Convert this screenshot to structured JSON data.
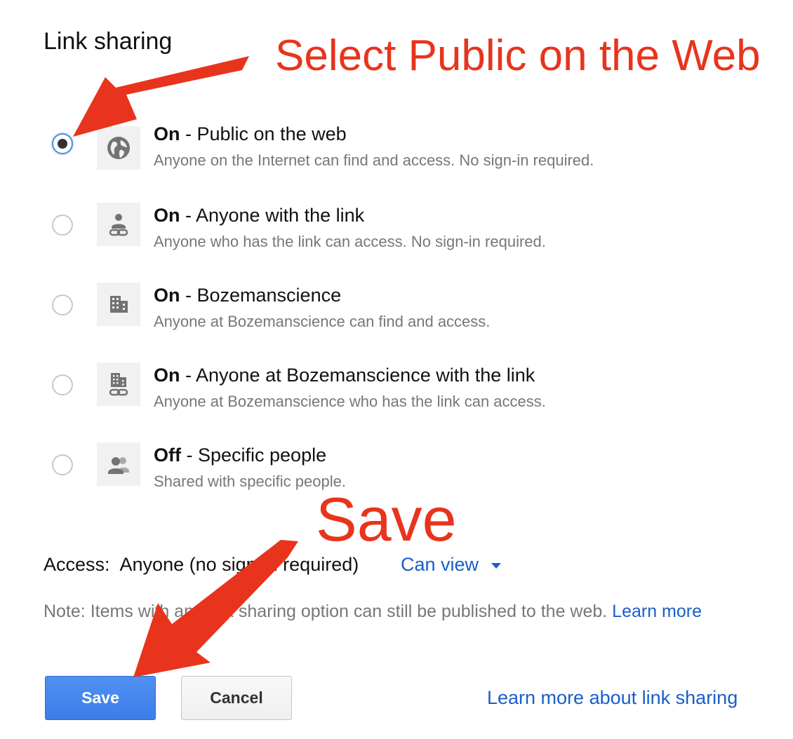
{
  "dialog": {
    "title": "Link sharing"
  },
  "annotations": {
    "top_callout": "Select Public on the Web",
    "save_callout": "Save",
    "color": "#e8341c"
  },
  "options": [
    {
      "state": "On",
      "label": " - Public on the web",
      "description": "Anyone on the Internet can find and access. No sign-in required.",
      "icon": "globe-icon",
      "selected": true
    },
    {
      "state": "On",
      "label": " - Anyone with the link",
      "description": "Anyone who has the link can access. No sign-in required.",
      "icon": "person-link-icon",
      "selected": false
    },
    {
      "state": "On",
      "label": " - Bozemanscience",
      "description": "Anyone at Bozemanscience can find and access.",
      "icon": "building-icon",
      "selected": false
    },
    {
      "state": "On",
      "label": " - Anyone at Bozemanscience with the link",
      "description": "Anyone at Bozemanscience who has the link can access.",
      "icon": "building-link-icon",
      "selected": false
    },
    {
      "state": "Off",
      "label": " - Specific people",
      "description": "Shared with specific people.",
      "icon": "people-icon",
      "selected": false
    }
  ],
  "access": {
    "label": "Access:",
    "value": "Anyone (no sign-in required)",
    "permission": "Can view"
  },
  "note": {
    "text": "Note: Items with any link sharing option can still be published to the web. ",
    "link": "Learn more"
  },
  "buttons": {
    "save": "Save",
    "cancel": "Cancel"
  },
  "footer_link": "Learn more about link sharing",
  "colors": {
    "link": "#1a5ec9",
    "primary_button": "#3b7de9"
  }
}
